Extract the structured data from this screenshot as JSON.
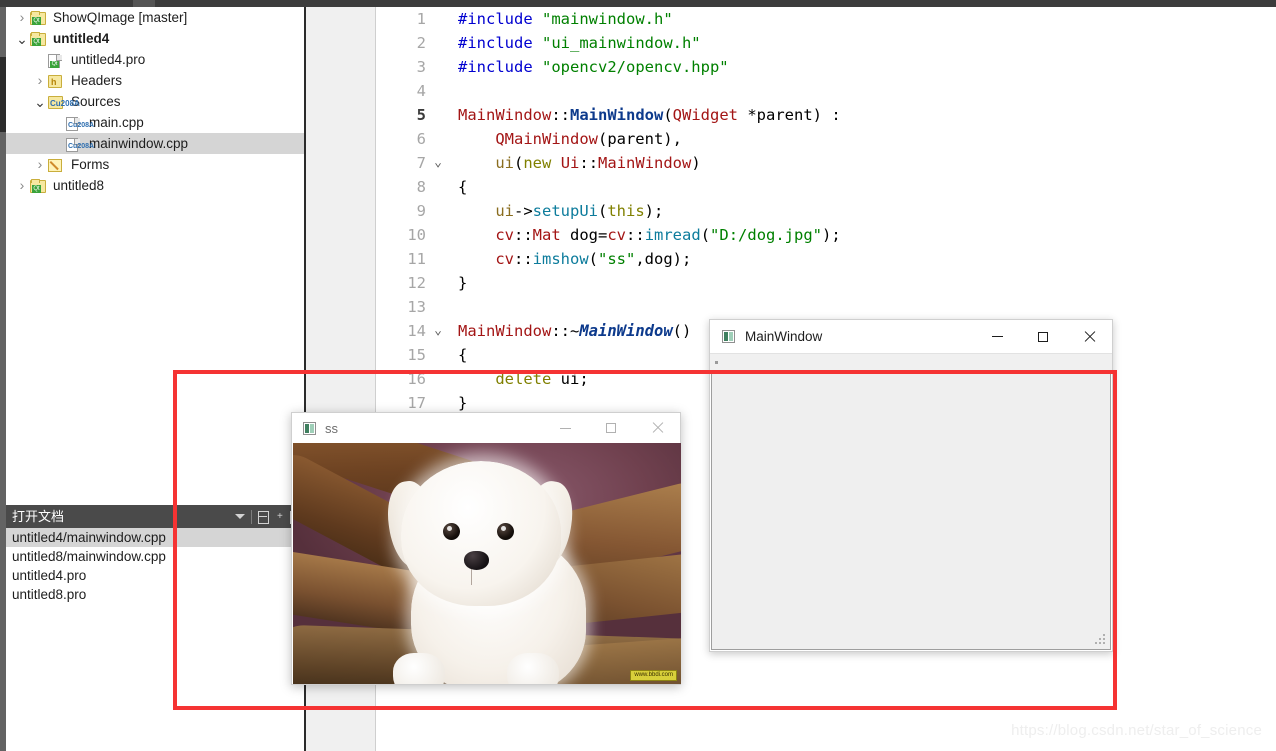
{
  "app": {
    "name": "Qt Creator",
    "colors": {
      "annotation_red": "#f53333",
      "selection_gray": "#d5d5d5",
      "panel_header": "#4a4a4a",
      "gutter": "#f0f0f0",
      "rail_dark": "#2b2b2b"
    }
  },
  "project_tree": {
    "items": [
      {
        "label": "ShowQImage [master]",
        "icon": "qt-project-folder-icon",
        "twisty": "collapsed",
        "indent": 0,
        "bold": false,
        "selected": false
      },
      {
        "label": "untitled4",
        "icon": "qt-project-folder-icon",
        "twisty": "expanded",
        "indent": 0,
        "bold": true,
        "selected": false
      },
      {
        "label": "untitled4.pro",
        "icon": "qt-pro-file-icon",
        "twisty": "none",
        "indent": 1,
        "bold": false,
        "selected": false
      },
      {
        "label": "Headers",
        "icon": "headers-folder-icon",
        "twisty": "collapsed",
        "indent": 1,
        "bold": false,
        "selected": false
      },
      {
        "label": "Sources",
        "icon": "sources-folder-icon",
        "twisty": "expanded",
        "indent": 1,
        "bold": false,
        "selected": false
      },
      {
        "label": "main.cpp",
        "icon": "cpp-file-icon",
        "twisty": "none",
        "indent": 2,
        "bold": false,
        "selected": false
      },
      {
        "label": "mainwindow.cpp",
        "icon": "cpp-file-icon",
        "twisty": "none",
        "indent": 2,
        "bold": false,
        "selected": true
      },
      {
        "label": "Forms",
        "icon": "forms-folder-icon",
        "twisty": "collapsed",
        "indent": 1,
        "bold": false,
        "selected": false
      },
      {
        "label": "untitled8",
        "icon": "qt-project-folder-icon",
        "twisty": "collapsed",
        "indent": 0,
        "bold": false,
        "selected": false
      }
    ]
  },
  "open_documents": {
    "title": "打开文档",
    "toolbar": {
      "dropdown": "chevron-down-icon",
      "split": "split-add-icon",
      "split_side": "split-side-icon"
    },
    "items": [
      {
        "label": "untitled4/mainwindow.cpp",
        "selected": true
      },
      {
        "label": "untitled8/mainwindow.cpp",
        "selected": false
      },
      {
        "label": "untitled4.pro",
        "selected": false
      },
      {
        "label": "untitled8.pro",
        "selected": false
      }
    ]
  },
  "editor": {
    "current_line": 5,
    "lines": [
      {
        "n": 1,
        "fold": "",
        "current": false,
        "tokens": [
          {
            "t": "#include ",
            "c": "pp"
          },
          {
            "t": "\"mainwindow.h\"",
            "c": "str"
          }
        ]
      },
      {
        "n": 2,
        "fold": "",
        "current": false,
        "tokens": [
          {
            "t": "#include ",
            "c": "pp"
          },
          {
            "t": "\"ui_mainwindow.h\"",
            "c": "str"
          }
        ]
      },
      {
        "n": 3,
        "fold": "",
        "current": false,
        "tokens": [
          {
            "t": "#include ",
            "c": "pp"
          },
          {
            "t": "\"opencv2/opencv.hpp\"",
            "c": "str"
          }
        ]
      },
      {
        "n": 4,
        "fold": "",
        "current": false,
        "tokens": []
      },
      {
        "n": 5,
        "fold": "",
        "current": true,
        "tokens": [
          {
            "t": "MainWindow",
            "c": "cls"
          },
          {
            "t": "::",
            "c": "pl"
          },
          {
            "t": "MainWindow",
            "c": "clsb"
          },
          {
            "t": "(",
            "c": "pl"
          },
          {
            "t": "QWidget",
            "c": "cls"
          },
          {
            "t": " *parent) :",
            "c": "pl"
          }
        ]
      },
      {
        "n": 6,
        "fold": "",
        "current": false,
        "tokens": [
          {
            "t": "    ",
            "c": "pl"
          },
          {
            "t": "QMainWindow",
            "c": "cls"
          },
          {
            "t": "(parent),",
            "c": "pl"
          }
        ]
      },
      {
        "n": 7,
        "fold": "v",
        "current": false,
        "tokens": [
          {
            "t": "    ",
            "c": "pl"
          },
          {
            "t": "ui",
            "c": "var"
          },
          {
            "t": "(",
            "c": "pl"
          },
          {
            "t": "new",
            "c": "kw"
          },
          {
            "t": " ",
            "c": "pl"
          },
          {
            "t": "Ui",
            "c": "cls"
          },
          {
            "t": "::",
            "c": "pl"
          },
          {
            "t": "MainWindow",
            "c": "cls"
          },
          {
            "t": ")",
            "c": "pl"
          }
        ]
      },
      {
        "n": 8,
        "fold": "",
        "current": false,
        "tokens": [
          {
            "t": "{",
            "c": "pl"
          }
        ]
      },
      {
        "n": 9,
        "fold": "",
        "current": false,
        "tokens": [
          {
            "t": "    ",
            "c": "pl"
          },
          {
            "t": "ui",
            "c": "var"
          },
          {
            "t": "->",
            "c": "pl"
          },
          {
            "t": "setupUi",
            "c": "fn"
          },
          {
            "t": "(",
            "c": "pl"
          },
          {
            "t": "this",
            "c": "kw"
          },
          {
            "t": ");",
            "c": "pl"
          }
        ]
      },
      {
        "n": 10,
        "fold": "",
        "current": false,
        "tokens": [
          {
            "t": "    ",
            "c": "pl"
          },
          {
            "t": "cv",
            "c": "cls"
          },
          {
            "t": "::",
            "c": "pl"
          },
          {
            "t": "Mat",
            "c": "cls"
          },
          {
            "t": " dog=",
            "c": "pl"
          },
          {
            "t": "cv",
            "c": "cls"
          },
          {
            "t": "::",
            "c": "pl"
          },
          {
            "t": "imread",
            "c": "fn"
          },
          {
            "t": "(",
            "c": "pl"
          },
          {
            "t": "\"D:/dog.jpg\"",
            "c": "str"
          },
          {
            "t": ");",
            "c": "pl"
          }
        ]
      },
      {
        "n": 11,
        "fold": "",
        "current": false,
        "tokens": [
          {
            "t": "    ",
            "c": "pl"
          },
          {
            "t": "cv",
            "c": "cls"
          },
          {
            "t": "::",
            "c": "pl"
          },
          {
            "t": "imshow",
            "c": "fn"
          },
          {
            "t": "(",
            "c": "pl"
          },
          {
            "t": "\"ss\"",
            "c": "str"
          },
          {
            "t": ",dog);",
            "c": "pl"
          }
        ]
      },
      {
        "n": 12,
        "fold": "",
        "current": false,
        "tokens": [
          {
            "t": "}",
            "c": "pl"
          }
        ]
      },
      {
        "n": 13,
        "fold": "",
        "current": false,
        "tokens": []
      },
      {
        "n": 14,
        "fold": "v",
        "current": false,
        "tokens": [
          {
            "t": "MainWindow",
            "c": "cls"
          },
          {
            "t": "::~",
            "c": "pl"
          },
          {
            "t": "MainWindow",
            "c": "dtor"
          },
          {
            "t": "()",
            "c": "pl"
          }
        ]
      },
      {
        "n": 15,
        "fold": "",
        "current": false,
        "tokens": [
          {
            "t": "{",
            "c": "pl"
          }
        ]
      },
      {
        "n": 16,
        "fold": "",
        "current": false,
        "tokens": [
          {
            "t": "    ",
            "c": "pl"
          },
          {
            "t": "delete",
            "c": "kw"
          },
          {
            "t": " ui;",
            "c": "pl"
          }
        ]
      },
      {
        "n": 17,
        "fold": "",
        "current": false,
        "tokens": [
          {
            "t": "}",
            "c": "pl"
          }
        ]
      }
    ]
  },
  "mainwindow_dialog": {
    "title": "MainWindow",
    "icon": "qt-window-icon",
    "buttons": {
      "minimize": "—",
      "maximize": "□",
      "close": "✕"
    },
    "resize_grip": "resize-grip-icon"
  },
  "image_window": {
    "title": "ss",
    "icon": "qt-window-icon",
    "buttons": {
      "minimize": "—",
      "maximize": "□",
      "close": "✕"
    },
    "image_alt": "white maltese puppy sitting on wood logs",
    "image_watermark": "www.bbdi.com"
  },
  "watermark": {
    "url": "https://blog.csdn.net/star_of_science"
  }
}
